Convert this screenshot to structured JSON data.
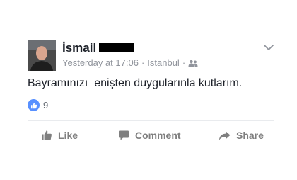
{
  "post": {
    "author": "İsmail",
    "timestamp": "Yesterday at 17:06",
    "location": "Istanbul",
    "separator": "·",
    "audience_icon": "friends-icon",
    "text": "Bayramınızı  enişten duygularınla kutlarım.",
    "reaction_count": "9"
  },
  "actions": {
    "like": "Like",
    "comment": "Comment",
    "share": "Share"
  },
  "colors": {
    "like_blue": "#5890ff",
    "meta_grey": "#90949c",
    "action_grey": "#7f7f7f",
    "redaction": "#000000"
  }
}
